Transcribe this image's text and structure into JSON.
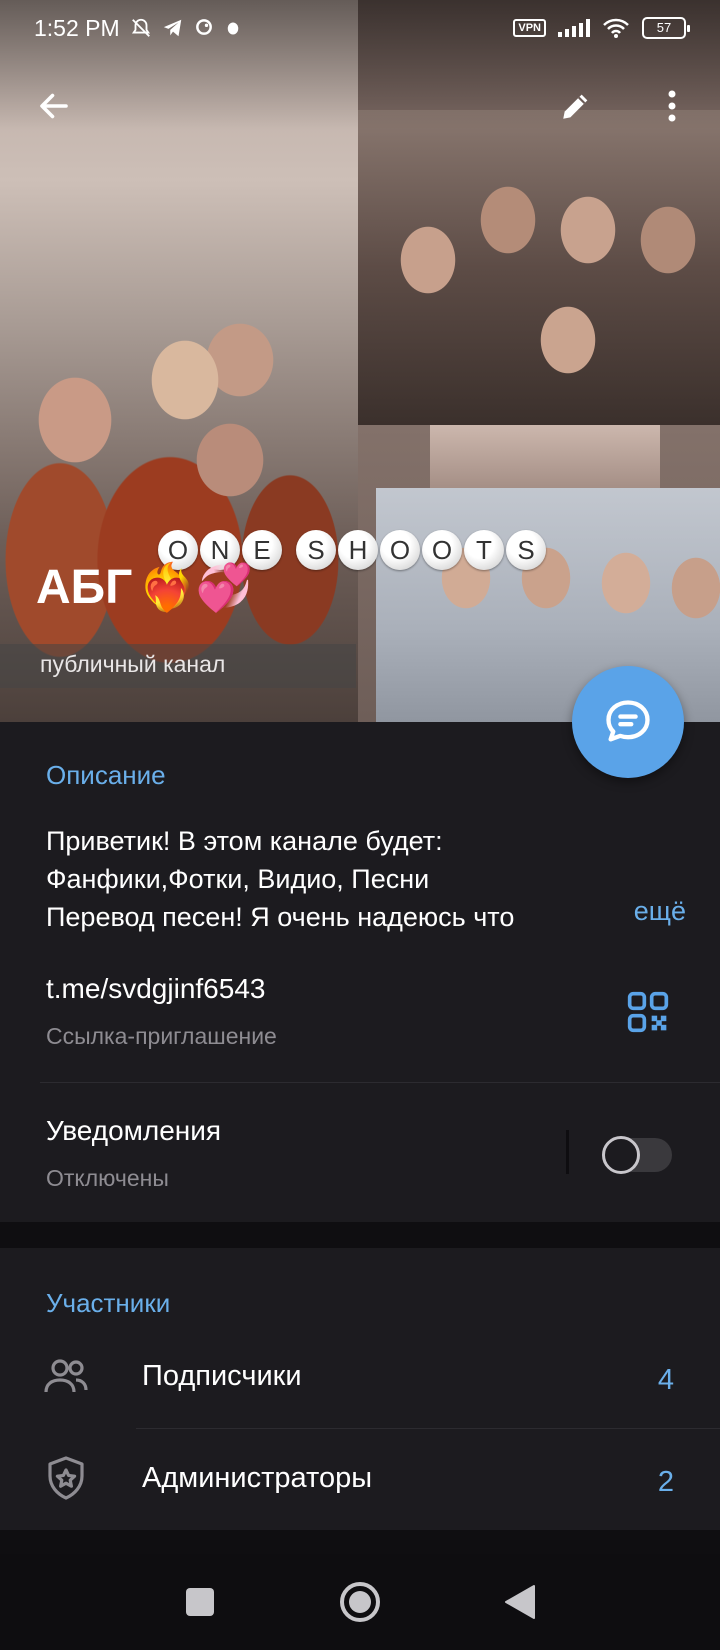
{
  "status_bar": {
    "time": "1:52 PM",
    "vpn_label": "VPN",
    "battery_level": "57",
    "icons": [
      "mute-bell-icon",
      "telegram-icon",
      "app-icon",
      "app-icon-2",
      "signal-icon",
      "wifi-icon",
      "battery-icon"
    ]
  },
  "toolbar": {
    "back_icon": "arrow-left-icon",
    "edit_icon": "pencil-icon",
    "menu_icon": "more-vertical-icon"
  },
  "channel": {
    "title": "АБГ",
    "title_emoji": "❤️‍🔥💞",
    "cover_lettering": [
      "O",
      "N",
      "E",
      "S",
      "H",
      "O",
      "O",
      "T",
      "S"
    ],
    "subtitle": "публичный канал"
  },
  "fab": {
    "icon": "chat-bubble-icon"
  },
  "description": {
    "header": "Описание",
    "lines": [
      "Приветик! В этом канале будет:",
      "Фанфики,Фотки, Видио, Песни",
      "Перевод песен! Я очень надеюсь что"
    ],
    "more_label": "ещё"
  },
  "invite_link": {
    "value": "t.me/svdgjinf6543",
    "label": "Ссылка-приглашение",
    "qr_icon": "qr-code-icon"
  },
  "notifications": {
    "title": "Уведомления",
    "status": "Отключены",
    "enabled": false
  },
  "members": {
    "header": "Участники",
    "rows": [
      {
        "label": "Подписчики",
        "count": "4",
        "icon": "people-icon"
      },
      {
        "label": "Администраторы",
        "count": "2",
        "icon": "admin-shield-icon"
      }
    ]
  },
  "colors": {
    "accent": "#6aafea",
    "fab": "#5aa3e8",
    "background": "#1c1b1f",
    "secondary_text": "#8e8c92"
  },
  "nav_bar": {
    "icons": [
      "recents-square-icon",
      "home-circle-icon",
      "back-triangle-icon"
    ]
  }
}
